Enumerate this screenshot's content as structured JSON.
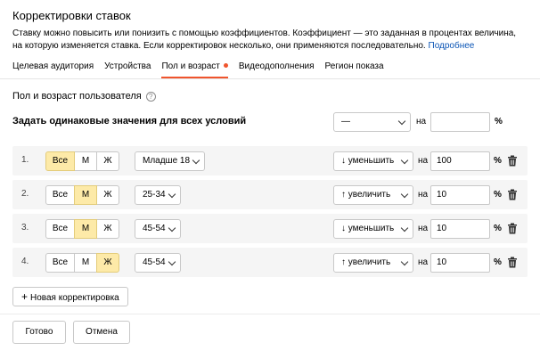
{
  "header": {
    "title": "Корректировки ставок",
    "description": "Ставку можно повысить или понизить с помощью коэффициентов. Коэффициент — это заданная в процентах величина, на которую изменяется ставка. Если корректировок несколько, они применяются последовательно.",
    "more_link": "Подробнее"
  },
  "tabs": [
    {
      "label": "Целевая аудитория",
      "active": false
    },
    {
      "label": "Устройства",
      "active": false
    },
    {
      "label": "Пол и возраст",
      "active": true,
      "dot": true
    },
    {
      "label": "Видеодополнения",
      "active": false
    },
    {
      "label": "Регион показа",
      "active": false
    }
  ],
  "section": {
    "title": "Пол и возраст пользователя",
    "help_icon": "?"
  },
  "same_values": {
    "label": "Задать одинаковые значения для всех условий",
    "select_value": "—",
    "na_label": "на",
    "input_value": "",
    "percent": "%"
  },
  "gender_options": [
    "Все",
    "М",
    "Ж"
  ],
  "rows": [
    {
      "num": "1.",
      "gender_selected": 0,
      "age": "Младше 18",
      "direction": "↓ уменьшить",
      "na": "на",
      "value": "100",
      "percent": "%"
    },
    {
      "num": "2.",
      "gender_selected": 1,
      "age": "25-34",
      "direction": "↑ увеличить",
      "na": "на",
      "value": "10",
      "percent": "%"
    },
    {
      "num": "3.",
      "gender_selected": 1,
      "age": "45-54",
      "direction": "↓ уменьшить",
      "na": "на",
      "value": "10",
      "percent": "%"
    },
    {
      "num": "4.",
      "gender_selected": 2,
      "age": "45-54",
      "direction": "↑ увеличить",
      "na": "на",
      "value": "10",
      "percent": "%"
    }
  ],
  "new_button": {
    "plus": "+",
    "label": "Новая корректировка"
  },
  "footer": {
    "done": "Готово",
    "cancel": "Отмена"
  },
  "colors": {
    "accent": "#f0552d",
    "selected": "#fdeaa8",
    "link": "#0a54b5",
    "row_bg": "#f5f5f5"
  },
  "icons": {
    "help": "question-circle-icon",
    "delete": "trash-icon",
    "dropdown": "chevron-down-icon"
  }
}
